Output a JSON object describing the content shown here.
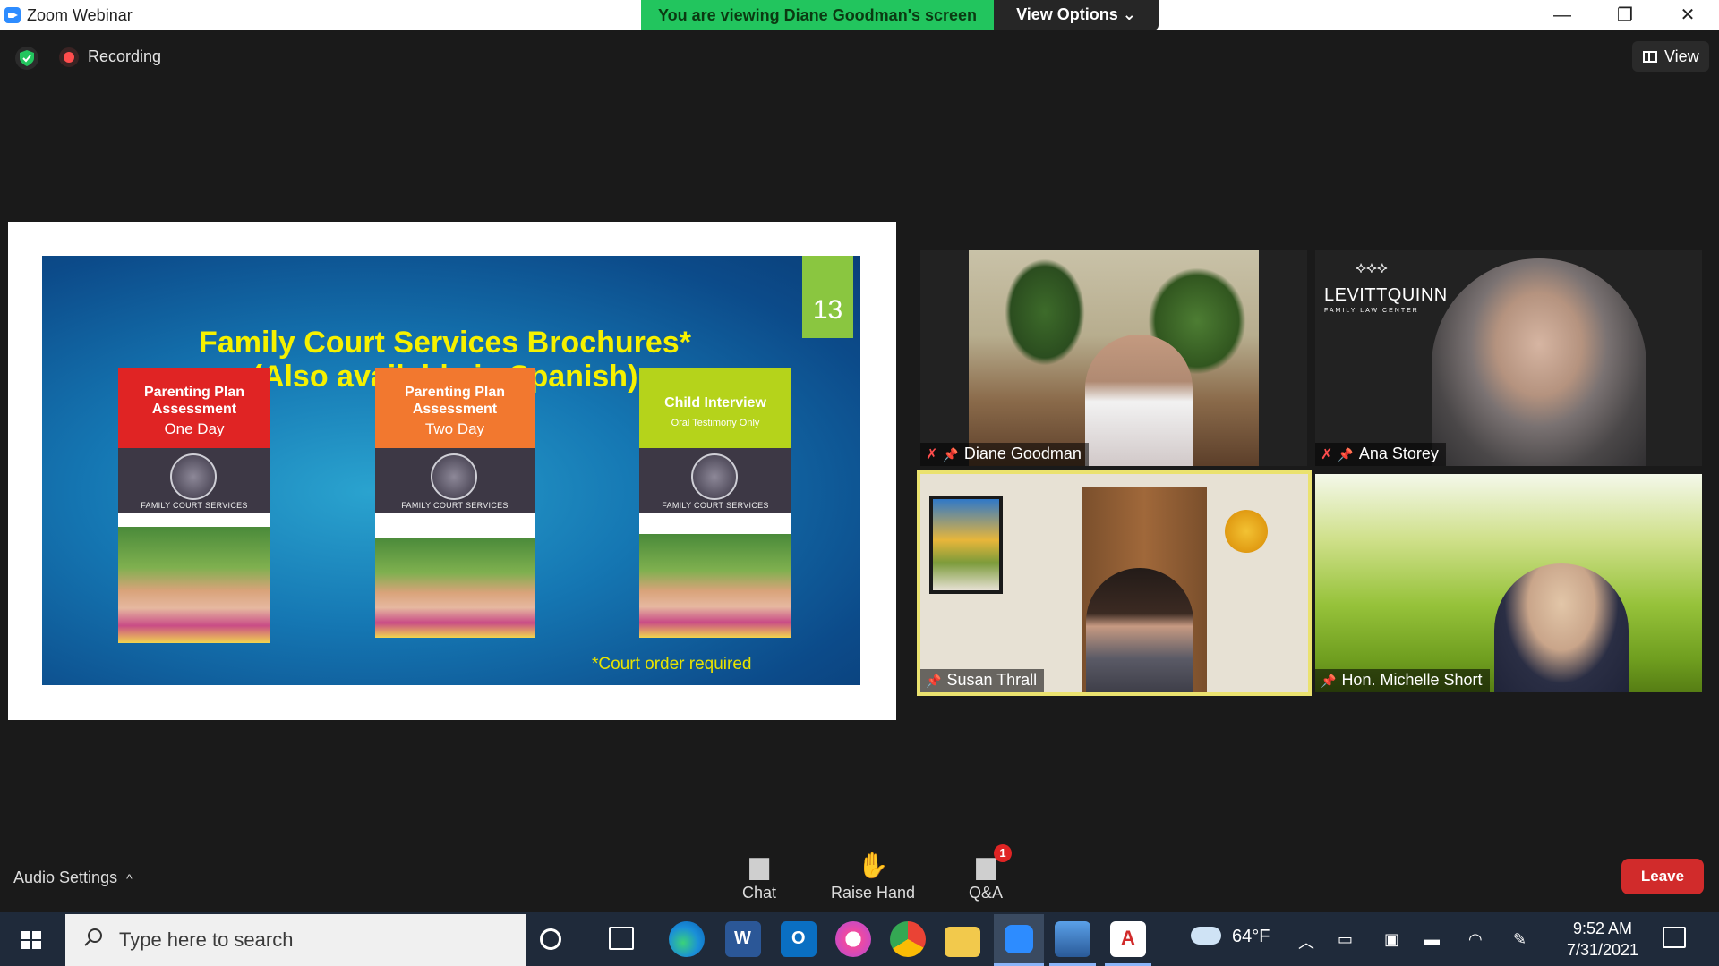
{
  "window": {
    "title": "Zoom Webinar",
    "viewing_banner": "You are viewing Diane Goodman's screen",
    "view_options": "View Options",
    "view_options_caret": "⌄",
    "minimize": "—",
    "maximize": "❐",
    "close": "✕"
  },
  "topbar": {
    "recording_label": "Recording",
    "view_label": "View"
  },
  "slide": {
    "number": "13",
    "title_line1": "Family Court Services Brochures*",
    "title_line2": "(Also available in Spanish)",
    "brochures": [
      {
        "title": "Parenting Plan Assessment",
        "subtitle": "One Day",
        "org": "FAMILY COURT SERVICES",
        "color": "#e02424"
      },
      {
        "title": "Parenting Plan Assessment",
        "subtitle": "Two Day",
        "org": "FAMILY COURT SERVICES",
        "color": "#f2782f"
      },
      {
        "title": "Child Interview",
        "subtitle": "Oral Testimony Only",
        "org": "FAMILY COURT SERVICES",
        "color": "#b5d31b"
      }
    ],
    "note": "*Court order required"
  },
  "participants": [
    {
      "name": "Diane Goodman",
      "muted": true,
      "icons": [
        "mic-muted-icon",
        "pin-icon"
      ]
    },
    {
      "name": "Ana Storey",
      "muted": true,
      "icons": [
        "mic-muted-icon",
        "pin-icon"
      ],
      "background_logo": "LEVITTQUINN",
      "background_logo_sub": "FAMILY LAW CENTER"
    },
    {
      "name": "Susan Thrall",
      "muted": false,
      "active_speaker": true,
      "icons": [
        "pin-icon"
      ]
    },
    {
      "name": "Hon. Michelle Short",
      "muted": false,
      "icons": [
        "pin-icon"
      ]
    }
  ],
  "toolbar": {
    "audio_settings": "Audio Settings",
    "audio_caret": "^",
    "chat": "Chat",
    "raise_hand": "Raise Hand",
    "qa": "Q&A",
    "qa_badge": "1",
    "leave": "Leave"
  },
  "taskbar": {
    "search_placeholder": "Type here to search",
    "temperature": "64°F",
    "time": "9:52 AM",
    "date": "7/31/2021"
  },
  "colors": {
    "banner_green": "#22c55e",
    "leave_red": "#d12b2b",
    "active_speaker_border": "#ebe26f",
    "slide_title_yellow": "#f6f100"
  }
}
